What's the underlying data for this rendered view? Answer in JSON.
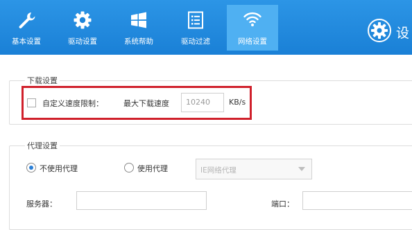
{
  "toolbar": {
    "items": [
      {
        "label": "基本设置",
        "icon": "wrench-icon"
      },
      {
        "label": "驱动设置",
        "icon": "gear-icon"
      },
      {
        "label": "系统帮助",
        "icon": "windows-logo-icon"
      },
      {
        "label": "驱动过滤",
        "icon": "list-icon"
      },
      {
        "label": "网络设置",
        "icon": "wifi-icon"
      }
    ],
    "active_index": 4,
    "settings_label": "设",
    "background": "#1a80d6",
    "active_background": "#4fb0f2"
  },
  "download": {
    "legend": "下载设置",
    "checkbox_label": "自定义速度限制：",
    "checked": false,
    "max_speed_label": "最大下载速度",
    "max_speed_value": "10240",
    "unit": "KB/s",
    "highlight_color": "#d0202b"
  },
  "proxy": {
    "legend": "代理设置",
    "options": [
      "不使用代理",
      "使用代理"
    ],
    "selected_index": 0,
    "proxy_type": "IE网络代理",
    "server_label": "服务器：",
    "server_value": "",
    "port_label": "端口："
  }
}
